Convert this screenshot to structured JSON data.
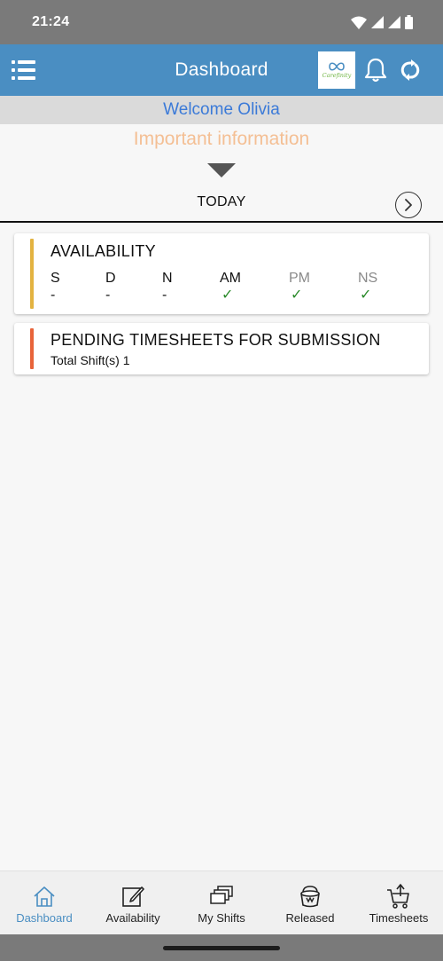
{
  "status_bar": {
    "time": "21:24"
  },
  "header": {
    "title": "Dashboard",
    "logo_text": "Carefinity"
  },
  "welcome": "Welcome Olivia",
  "important_info": "Important information",
  "date_nav": {
    "label": "TODAY"
  },
  "availability": {
    "title": "AVAILABILITY",
    "columns": [
      {
        "label": "S",
        "value": "-",
        "available": false,
        "muted": false
      },
      {
        "label": "D",
        "value": "-",
        "available": false,
        "muted": false
      },
      {
        "label": "N",
        "value": "-",
        "available": false,
        "muted": false
      },
      {
        "label": "AM",
        "value": "✓",
        "available": true,
        "muted": false
      },
      {
        "label": "PM",
        "value": "✓",
        "available": true,
        "muted": true
      },
      {
        "label": "NS",
        "value": "✓",
        "available": true,
        "muted": true
      }
    ]
  },
  "pending": {
    "title": "PENDING TIMESHEETS FOR SUBMISSION",
    "subtitle": "Total Shift(s) 1"
  },
  "bottom_nav": [
    {
      "label": "Dashboard",
      "icon": "home-icon",
      "active": true
    },
    {
      "label": "Availability",
      "icon": "edit-icon",
      "active": false
    },
    {
      "label": "My Shifts",
      "icon": "stack-icon",
      "active": false
    },
    {
      "label": "Released",
      "icon": "bucket-icon",
      "active": false
    },
    {
      "label": "Timesheets",
      "icon": "cart-icon",
      "active": false
    }
  ],
  "colors": {
    "header": "#4a8ec2",
    "availability_accent": "#e3b341",
    "pending_accent": "#e8643a",
    "welcome_text": "#3b7ad8",
    "important_text": "#f4bf94",
    "check": "#2a8a2a"
  }
}
